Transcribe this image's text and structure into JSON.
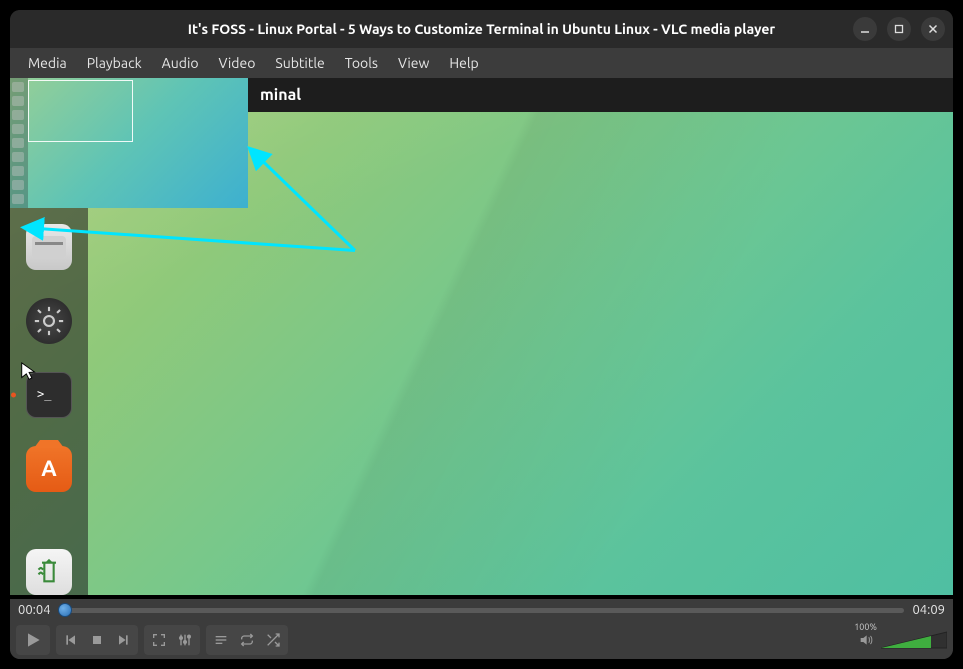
{
  "window": {
    "title": "It's FOSS - Linux Portal - 5 Ways to Customize Terminal in Ubuntu Linux - VLC media player"
  },
  "menubar": {
    "items": [
      "Media",
      "Playback",
      "Audio",
      "Video",
      "Subtitle",
      "Tools",
      "View",
      "Help"
    ]
  },
  "video": {
    "topbar_text": "minal",
    "dock_items": [
      "files",
      "settings",
      "terminal",
      "software",
      "trash"
    ]
  },
  "playback": {
    "elapsed": "00:04",
    "total": "04:09",
    "progress_percent": 1.6
  },
  "volume": {
    "percent_label": "100%",
    "level": 100
  },
  "controls": {
    "play": "Play",
    "prev": "Previous",
    "stop": "Stop",
    "next": "Next",
    "fullscreen": "Fullscreen",
    "ext_settings": "Extended settings",
    "playlist": "Playlist",
    "loop": "Loop",
    "shuffle": "Shuffle"
  },
  "window_controls": {
    "minimize": "Minimize",
    "maximize": "Maximize",
    "close": "Close"
  },
  "colors": {
    "annotation": "#00e5ff"
  }
}
